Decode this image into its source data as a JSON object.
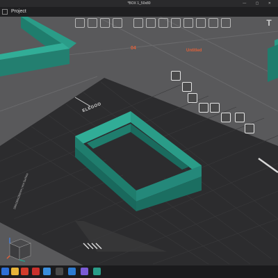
{
  "window": {
    "title": "*BOX 1_50x80",
    "controls": "—  ▢  ✕"
  },
  "menubar": {
    "project_label": "Project"
  },
  "plate": {
    "number": "04",
    "name": "Untitled",
    "brand": "ELEGOO",
    "size_text": "256x256x256mm | Hot Surface"
  },
  "toolbar": {
    "text_tool_glyph": "T"
  },
  "colors": {
    "accent": "#e1613a",
    "model": "#2a9c88",
    "bed": "#2c2c2e",
    "grid": "#3c3c3e",
    "background": "#5a5a5c"
  },
  "taskbar": {
    "icons": [
      "windows-start-icon",
      "explorer-icon",
      "app-icon",
      "pdf-icon",
      "files-icon",
      "calc-icon",
      "mail-icon",
      "video-icon",
      "slicer-icon"
    ]
  }
}
